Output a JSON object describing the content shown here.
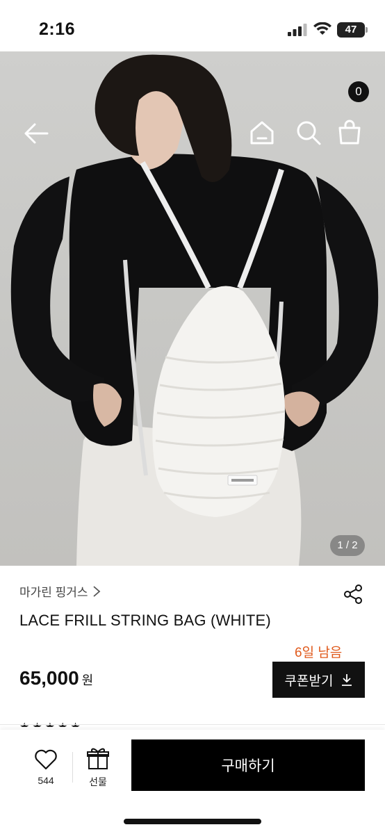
{
  "status": {
    "time": "2:16",
    "battery": "47"
  },
  "nav": {
    "back_icon": "arrow-left-icon",
    "home_icon": "home-icon",
    "search_icon": "search-icon",
    "cart_icon": "shopping-bag-icon",
    "cart_count": "0"
  },
  "hero": {
    "pager": "1 / 2"
  },
  "product": {
    "brand": "마가린 핑거스",
    "title": "LACE FRILL STRING BAG (WHITE)",
    "days_left": "6일 남음",
    "price": "65,000",
    "currency": "원",
    "coupon_label": "쿠폰받기",
    "review_stars": "★★★★★"
  },
  "bottom": {
    "like_count": "544",
    "gift_label": "선물",
    "buy_label": "구매하기"
  },
  "colors": {
    "accent_orange": "#e05a1c",
    "primary": "#000000"
  }
}
